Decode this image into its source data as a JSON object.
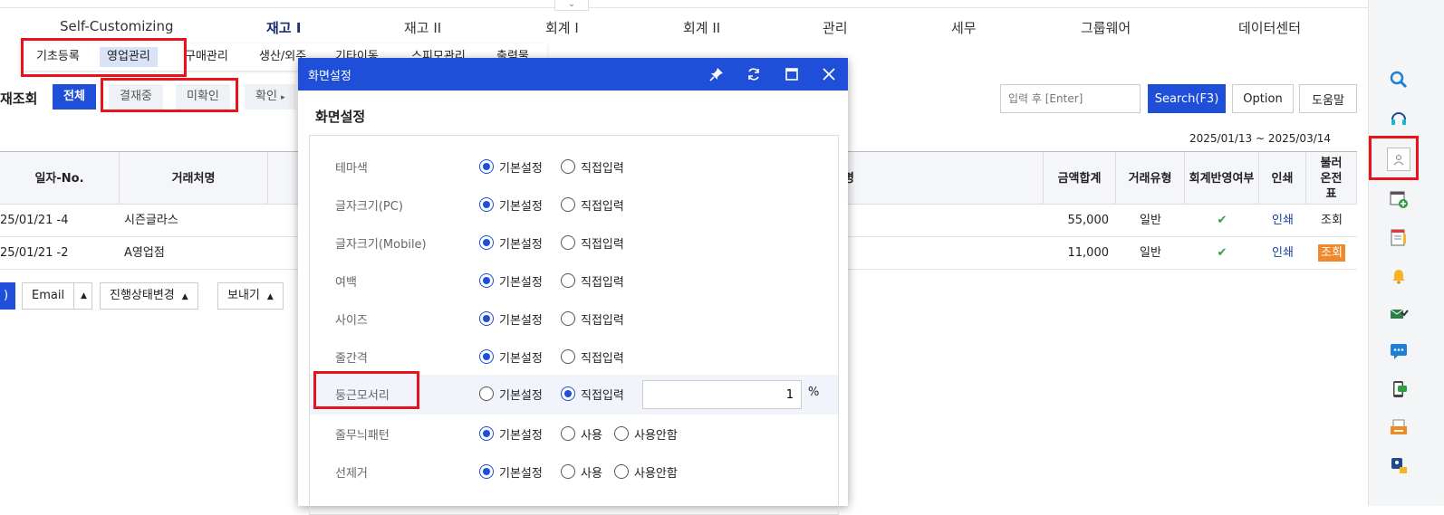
{
  "topnav": {
    "items": [
      "Self-Customizing",
      "재고 I",
      "재고 II",
      "회계 I",
      "회계 II",
      "관리",
      "세무",
      "그룹웨어",
      "데이터센터"
    ],
    "toggle_glyph": "⌄"
  },
  "submenu": {
    "items": [
      "기초등록",
      "영업관리",
      "구매관리",
      "생산/외주",
      "기타이동",
      "스피모관리",
      "출력물"
    ]
  },
  "page": {
    "title": "재조회",
    "filters": [
      "전체",
      "결재중",
      "미확인",
      "확인"
    ],
    "search_placeholder": "입력 후 [Enter]",
    "search_label": "Search(F3)",
    "option_label": "Option",
    "help_label": "도움말",
    "date_range": "2025/01/13 ~ 2025/03/14"
  },
  "table": {
    "headers": [
      "일자-No.",
      "거래처명",
      "명",
      "금액합계",
      "거래유형",
      "회계반영여부",
      "인쇄",
      "불러온전표"
    ],
    "rows": [
      {
        "date_no": "25/01/21 -4",
        "customer": "시즌글라스",
        "amount": "55,000",
        "type": "일반",
        "check": "✔",
        "print": "인쇄",
        "load": "조회"
      },
      {
        "date_no": "25/01/21 -2",
        "customer": "A영업점",
        "amount": "11,000",
        "type": "일반",
        "check": "✔",
        "print": "인쇄",
        "load": "조회"
      }
    ]
  },
  "bottom": {
    "first": ")",
    "email": "Email",
    "status_change": "진행상태변경",
    "export": "보내기",
    "tri": "▲"
  },
  "modal": {
    "title": "화면설정",
    "subtitle": "화면설정",
    "settings": [
      {
        "label": "테마색",
        "opts": [
          "기본설정",
          "직접입력"
        ],
        "sel": 0
      },
      {
        "label": "글자크기(PC)",
        "opts": [
          "기본설정",
          "직접입력"
        ],
        "sel": 0
      },
      {
        "label": "글자크기(Mobile)",
        "opts": [
          "기본설정",
          "직접입력"
        ],
        "sel": 0
      },
      {
        "label": "여백",
        "opts": [
          "기본설정",
          "직접입력"
        ],
        "sel": 0
      },
      {
        "label": "사이즈",
        "opts": [
          "기본설정",
          "직접입력"
        ],
        "sel": 0
      },
      {
        "label": "줄간격",
        "opts": [
          "기본설정",
          "직접입력"
        ],
        "sel": 0
      },
      {
        "label": "둥근모서리",
        "opts": [
          "기본설정",
          "직접입력"
        ],
        "sel": 1
      },
      {
        "label": "줄무늬패턴",
        "opts": [
          "기본설정",
          "사용",
          "사용안함"
        ],
        "sel": 0
      },
      {
        "label": "선제거",
        "opts": [
          "기본설정",
          "사용",
          "사용안함"
        ],
        "sel": 0
      }
    ],
    "radius_value": "1",
    "radius_unit": "%"
  },
  "colors": {
    "accent": "#1f4ed8",
    "highlight": "#e8131b",
    "badge": "#ef8a2c"
  }
}
